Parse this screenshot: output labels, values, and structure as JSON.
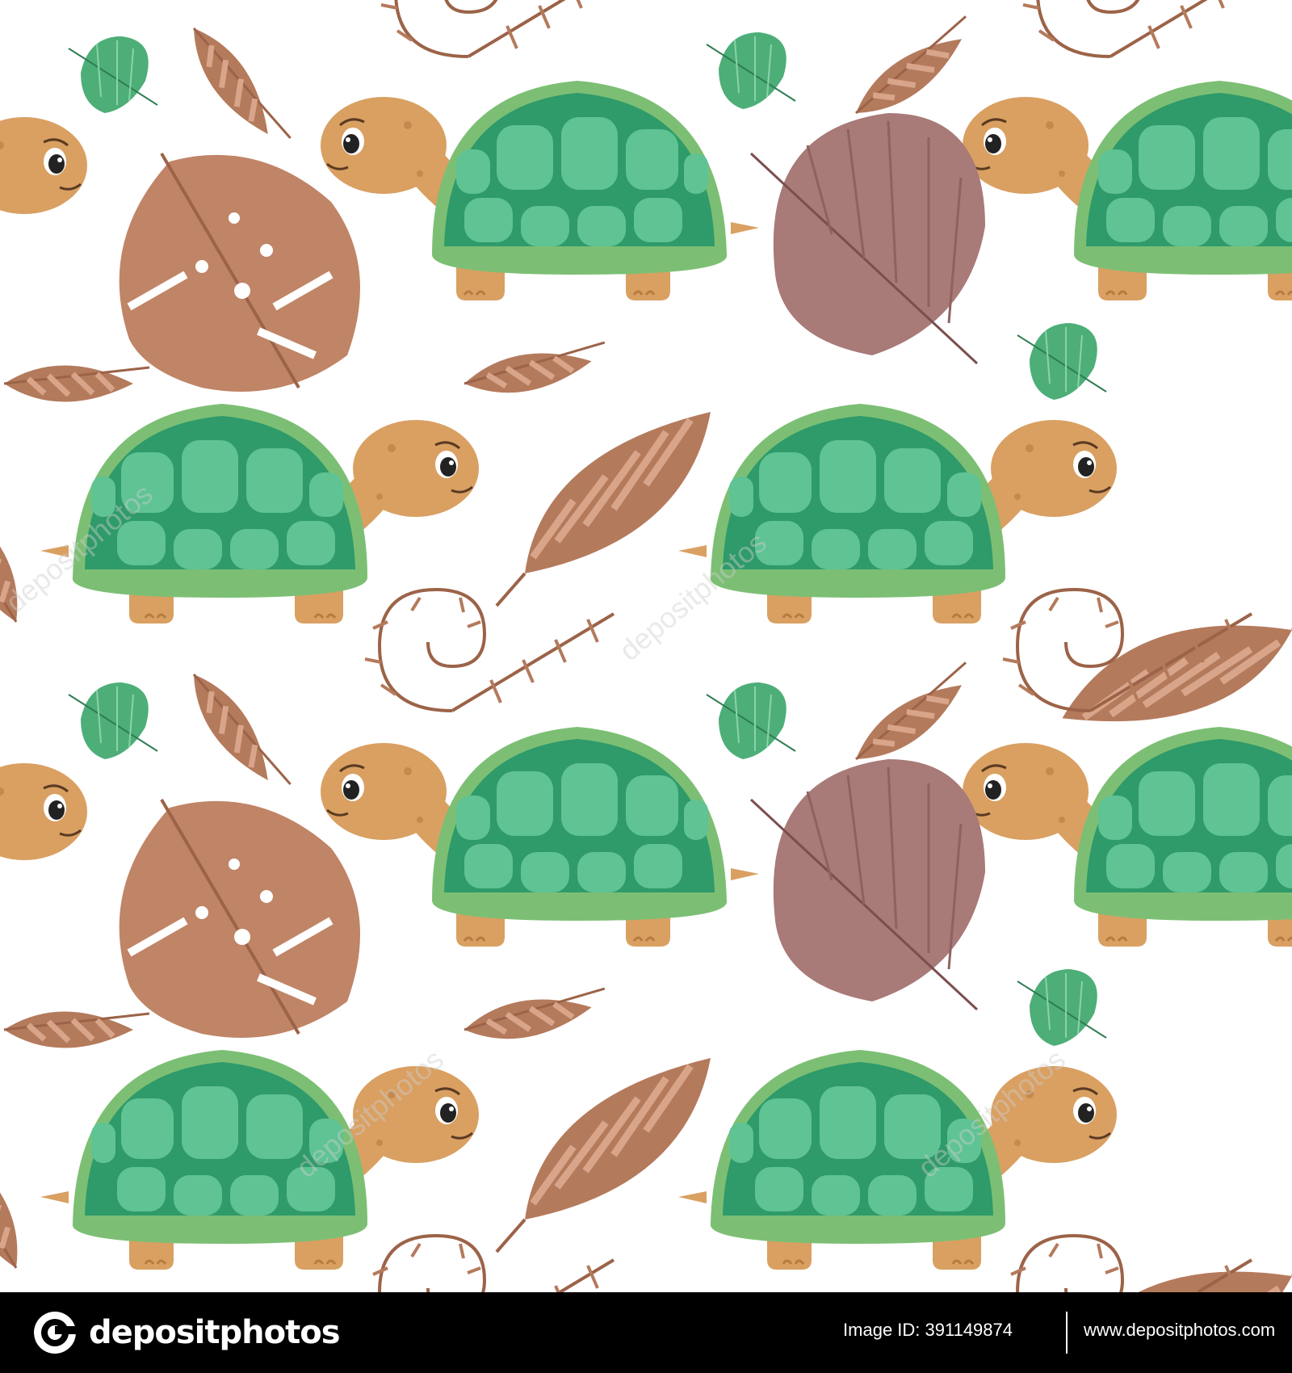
{
  "footer": {
    "logo_text": "depositphotos",
    "image_id": "Image ID: 391149874",
    "site_url": "www.depositphotos.com"
  },
  "watermark": "depositphotos",
  "colors": {
    "shell_dark": "#2f9a6a",
    "shell_light": "#5fc394",
    "shell_rim": "#7cbf74",
    "skin": "#d9a062",
    "skin_dark": "#b77a3f",
    "leaf_brown": "#b47a5c",
    "leaf_brown_light": "#d9a58a",
    "leaf_mauve": "#a87a78",
    "leaf_green": "#4dae78",
    "footer_bg": "#000000"
  },
  "icons": {
    "logo": "depositphotos-logo-icon"
  }
}
